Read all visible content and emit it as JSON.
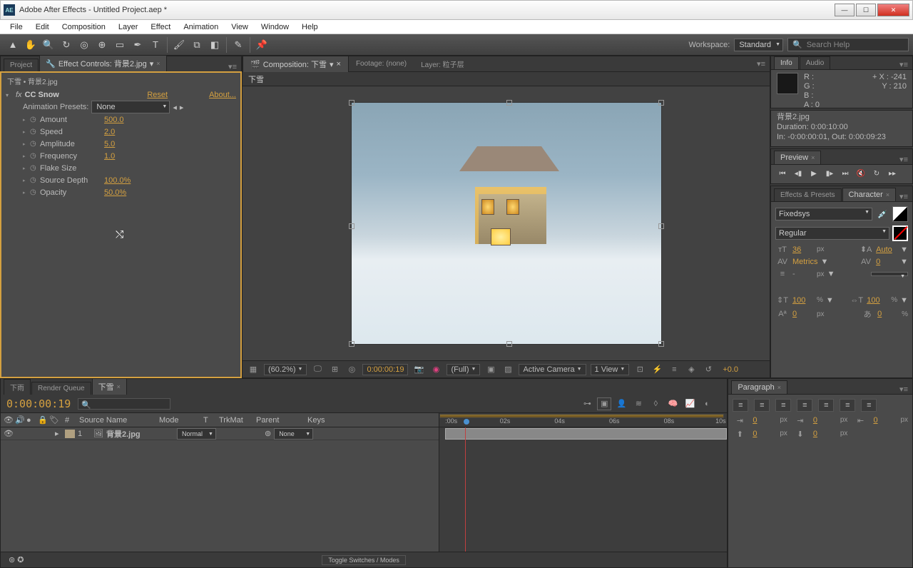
{
  "titlebar": {
    "app_icon": "AE",
    "title": "Adobe After Effects - Untitled Project.aep *"
  },
  "menubar": [
    "File",
    "Edit",
    "Composition",
    "Layer",
    "Effect",
    "Animation",
    "View",
    "Window",
    "Help"
  ],
  "toolbar": {
    "workspace_label": "Workspace:",
    "workspace_value": "Standard",
    "search_pc": "Search Help"
  },
  "left": {
    "project_tab": "Project",
    "effect_tab": "Effect Controls: 背景2.jpg",
    "breadcrumb": "下雪 • 背景2.jpg",
    "effect_name": "CC Snow",
    "reset": "Reset",
    "about": "About...",
    "presets_label": "Animation Presets:",
    "presets_value": "None",
    "props": [
      {
        "label": "Amount",
        "val": "500.0"
      },
      {
        "label": "Speed",
        "val": "2.0"
      },
      {
        "label": "Amplitude",
        "val": "5.0"
      },
      {
        "label": "Frequency",
        "val": "1.0"
      },
      {
        "label": "Flake Size",
        "val": ""
      },
      {
        "label": "Source Depth",
        "val": "100.0%"
      },
      {
        "label": "Opacity",
        "val": "50.0%"
      }
    ]
  },
  "center": {
    "comp_tab": "Composition: 下雪",
    "footage_tab": "Footage: (none)",
    "layer_tab": "Layer: 粒子层",
    "breadcrumb": "下雪",
    "zoom": "(60.2%)",
    "time": "0:00:00:19",
    "mode": "(Full)",
    "camera": "Active Camera",
    "views": "1 View",
    "exposure": "+0.0"
  },
  "right": {
    "info_tab": "Info",
    "audio_tab": "Audio",
    "rgb": {
      "R": "R :",
      "G": "G :",
      "B": "B :",
      "A": "A : 0"
    },
    "xy": {
      "X": "X : -241",
      "Y": "Y : 210"
    },
    "meta_name": "背景2.jpg",
    "meta_dur": "Duration: 0:00:10:00",
    "meta_io": "In: -0:00:00:01, Out: 0:00:09:23",
    "preview_tab": "Preview",
    "ep_tab": "Effects & Presets",
    "char_tab": "Character",
    "font": "Fixedsys",
    "style": "Regular",
    "size": "36",
    "leading": "Auto",
    "kerning": "Metrics",
    "tracking": "0",
    "vscale": "100",
    "hscale": "100",
    "baseline": "0",
    "tsume": "0",
    "px": "px",
    "pct": "%",
    "dash": "-",
    "para_tab": "Paragraph",
    "indent_left": "0",
    "indent_right": "0",
    "indent_first": "0",
    "space_before": "0",
    "space_after": "0"
  },
  "timeline": {
    "tabs": [
      "下雨",
      "Render Queue",
      "下雪"
    ],
    "timecode": "0:00:00:19",
    "search_pc": "",
    "cols": {
      "num": "#",
      "source": "Source Name",
      "mode": "Mode",
      "t": "T",
      "trkmat": "TrkMat",
      "parent": "Parent",
      "keys": "Keys"
    },
    "ruler": [
      ":00s",
      "02s",
      "04s",
      "06s",
      "08s",
      "10s"
    ],
    "layer": {
      "num": "1",
      "name": "背景2.jpg",
      "mode": "Normal",
      "parent": "None"
    },
    "footer": "Toggle Switches / Modes"
  }
}
